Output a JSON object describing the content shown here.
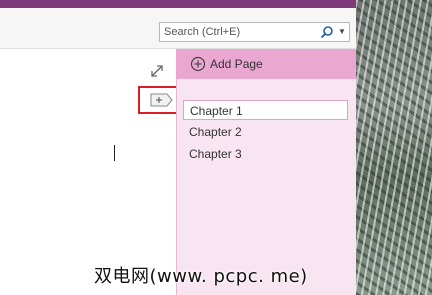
{
  "search": {
    "placeholder": "Search (Ctrl+E)"
  },
  "pages_pane": {
    "add_page_label": "Add Page",
    "pages": [
      "Chapter 1",
      "Chapter 2",
      "Chapter 3"
    ]
  },
  "watermark": "双电网(www. pcpc. me)",
  "colors": {
    "accent": "#80397b",
    "add_page_bg": "#eaa7d2",
    "pane_bg": "#f9e4f1",
    "highlight": "#d91f26"
  },
  "icons": [
    "search-icon",
    "expand-icon",
    "new-section-icon",
    "add-page-icon"
  ]
}
